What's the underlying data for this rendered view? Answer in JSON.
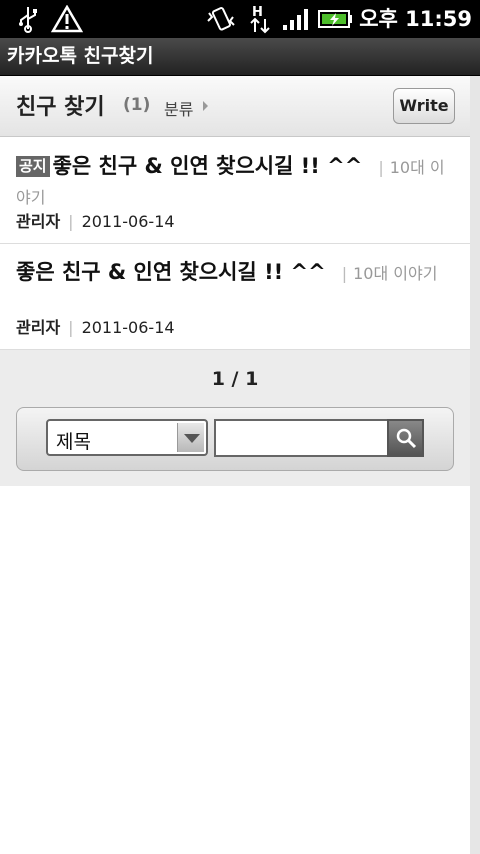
{
  "status_bar": {
    "icons": [
      "usb-icon",
      "warning-icon",
      "vibrate-icon",
      "hspa-data-icon",
      "signal-icon",
      "battery-charging-icon"
    ],
    "h_label": "H",
    "time": "오후 11:59"
  },
  "window": {
    "title": "카카오톡 친구찾기"
  },
  "header": {
    "title": "친구 찾기",
    "count": "(1)",
    "category_label": "분류",
    "write_label": "Write"
  },
  "posts": [
    {
      "badge": "공지",
      "title": "좋은 친구 & 인연 찾으시길 !! ^^",
      "board": "10대 이야기",
      "author": "관리자",
      "date": "2011-06-14"
    },
    {
      "badge": "",
      "title": "좋은 친구 & 인연 찾으시길 !! ^^",
      "board": "10대 이야기",
      "author": "관리자",
      "date": "2011-06-14"
    }
  ],
  "pager": {
    "text": "1 / 1"
  },
  "search": {
    "field_selected": "제목",
    "query_value": "",
    "button_icon": "search-icon"
  }
}
